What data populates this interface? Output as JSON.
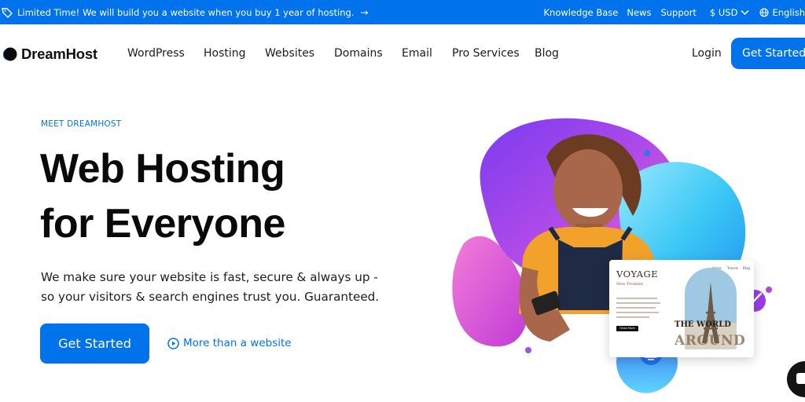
{
  "promo": {
    "text": "Limited Time! We will build you a website when you buy 1 year of hosting.",
    "arrow": "→"
  },
  "utility": {
    "knowledge_base": "Knowledge Base",
    "news": "News",
    "support": "Support",
    "currency": "$ USD",
    "language": "English"
  },
  "brand": {
    "name": "DreamHost"
  },
  "nav": {
    "items": [
      "WordPress",
      "Hosting",
      "Websites",
      "Domains",
      "Email",
      "Pro Services",
      "Blog"
    ],
    "login": "Login",
    "cta": "Get Started"
  },
  "hero": {
    "eyebrow": "MEET DREAMHOST",
    "headline_line1": "Web Hosting",
    "headline_line2": "for Everyone",
    "subcopy": "We make sure your website is fast, secure & always up - so your visitors & search engines trust you. Guaranteed.",
    "cta": "Get Started",
    "secondary_link": "More than a website"
  },
  "mockup": {
    "title": "VOYAGE",
    "subtitle": "New Frontier",
    "nav": [
      "Home",
      "Travels",
      "Blog"
    ],
    "button": "Show More",
    "world": "THE WORLD",
    "around": "AROUND"
  },
  "colors": {
    "brand_blue": "#0073ec",
    "text": "#111111",
    "blob_purple": "#a43cf0",
    "blob_pink": "#e255c8",
    "blob_cyan": "#3cc8f5"
  },
  "icons": {
    "promo": "tag-icon",
    "currency": "chevron-down-icon",
    "language": "globe-icon",
    "secondary_link": "play-circle-icon",
    "chat": "chat-icon"
  }
}
